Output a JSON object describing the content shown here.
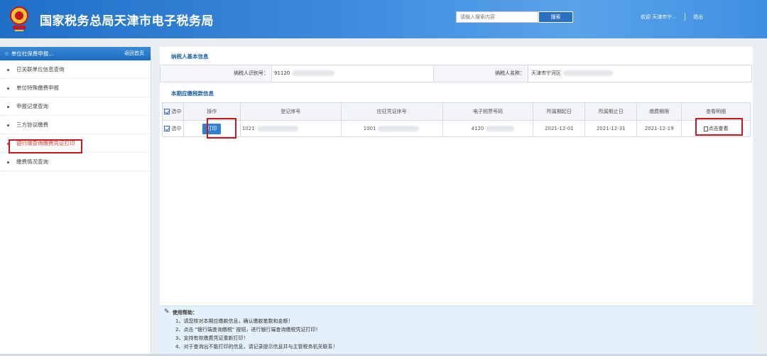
{
  "header": {
    "title": "国家税务总局天津市电子税务局",
    "search_placeholder": "请输入搜索内容",
    "search_button": "搜索",
    "welcome": "欢迎 天津市宁...",
    "logout": "退出"
  },
  "sidebar": {
    "title": "单位社保费申报...",
    "back_home": "返回首页",
    "items": [
      {
        "label": "已关联单位信息查询"
      },
      {
        "label": "单位特殊缴费申报"
      },
      {
        "label": "申报记录查询"
      },
      {
        "label": "三方协议缴费"
      },
      {
        "label": "银行端查询缴费凭证打印"
      },
      {
        "label": "缴费情况查询"
      }
    ]
  },
  "main": {
    "basic_info_title": "纳税人基本信息",
    "taxpayer_id_label": "纳税人识别号：",
    "taxpayer_id_value": "91120",
    "taxpayer_name_label": "纳税人名称：",
    "taxpayer_name_value": "天津市宁河区",
    "payment_info_title": "本期应缴税款信息",
    "columns": [
      "选中",
      "操作",
      "登记序号",
      "应征凭证序号",
      "电子税票号码",
      "所属期起日",
      "所属期止日",
      "缴费期限",
      "查看明细"
    ],
    "row": {
      "select_label": "选中",
      "action_label": "打印",
      "reg_no": "1021",
      "voucher_no": "1001",
      "ticket_no": "4120",
      "period_start": "2021-12-01",
      "period_end": "2021-12-31",
      "deadline": "2021-12-19",
      "view_label": "点击查看"
    }
  },
  "help": {
    "title": "使用帮助：",
    "lines": [
      "1、请您核对本期应缴款信息，确认缴款笔数和金额！",
      "2、点击 \"银行端查询缴税\" 按钮，进行银行端查询缴税凭证打印！",
      "3、支持有效缴费凭证重新打印！",
      "4、对于查询出不能打印的信息，请记录提示信息并与主管税务机关联系！"
    ]
  },
  "colors": {
    "header_blue": "#2a7bd4",
    "highlight_red": "#c8171c",
    "help_bg": "#e4f0fb"
  }
}
